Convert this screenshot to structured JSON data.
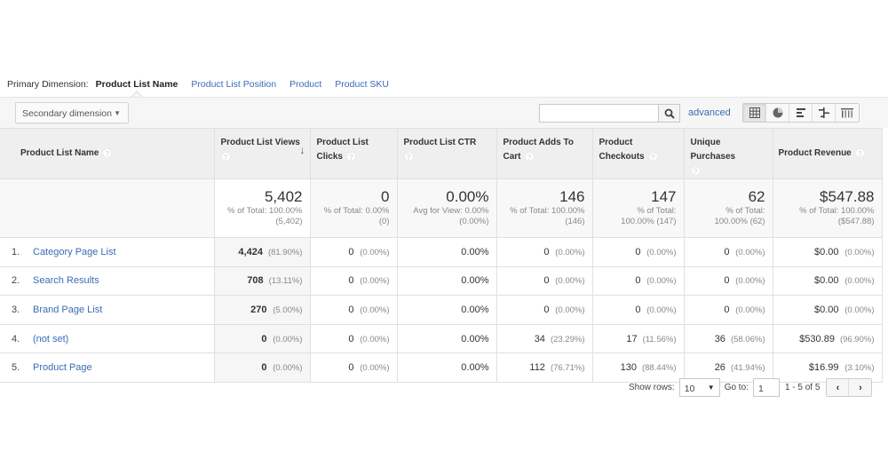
{
  "primary_dimension": {
    "label": "Primary Dimension:",
    "active": "Product List Name",
    "options": [
      "Product List Position",
      "Product",
      "Product SKU"
    ]
  },
  "toolbar": {
    "secondary_dimension_label": "Secondary dimension",
    "search_value": "",
    "advanced_label": "advanced",
    "view_icons": [
      "table-view-icon",
      "pie-view-icon",
      "performance-view-icon",
      "comparison-view-icon",
      "pivot-view-icon"
    ]
  },
  "table": {
    "columns": [
      {
        "label": "Product List Name"
      },
      {
        "label": "Product List Views",
        "sorted": true
      },
      {
        "label": "Product List Clicks"
      },
      {
        "label": "Product List CTR"
      },
      {
        "label": "Product Adds To Cart"
      },
      {
        "label": "Product Checkouts"
      },
      {
        "label": "Unique Purchases"
      },
      {
        "label": "Product Revenue"
      }
    ],
    "totals": [
      {
        "value": "5,402",
        "sub1": "% of Total: 100.00%",
        "sub2": "(5,402)"
      },
      {
        "value": "0",
        "sub1": "% of Total: 0.00%",
        "sub2": "(0)"
      },
      {
        "value": "0.00%",
        "sub1": "Avg for View: 0.00%",
        "sub2": "(0.00%)"
      },
      {
        "value": "146",
        "sub1": "% of Total: 100.00%",
        "sub2": "(146)"
      },
      {
        "value": "147",
        "sub1": "% of Total:",
        "sub2": "100.00% (147)"
      },
      {
        "value": "62",
        "sub1": "% of Total:",
        "sub2": "100.00% (62)"
      },
      {
        "value": "$547.88",
        "sub1": "% of Total: 100.00%",
        "sub2": "($547.88)"
      }
    ],
    "rows": [
      {
        "index": "1.",
        "name": "Category Page List",
        "cells": [
          {
            "v": "4,424",
            "p": "(81.90%)"
          },
          {
            "v": "0",
            "p": "(0.00%)"
          },
          {
            "v": "0.00%",
            "p": ""
          },
          {
            "v": "0",
            "p": "(0.00%)"
          },
          {
            "v": "0",
            "p": "(0.00%)"
          },
          {
            "v": "0",
            "p": "(0.00%)"
          },
          {
            "v": "$0.00",
            "p": "(0.00%)"
          }
        ]
      },
      {
        "index": "2.",
        "name": "Search Results",
        "cells": [
          {
            "v": "708",
            "p": "(13.11%)"
          },
          {
            "v": "0",
            "p": "(0.00%)"
          },
          {
            "v": "0.00%",
            "p": ""
          },
          {
            "v": "0",
            "p": "(0.00%)"
          },
          {
            "v": "0",
            "p": "(0.00%)"
          },
          {
            "v": "0",
            "p": "(0.00%)"
          },
          {
            "v": "$0.00",
            "p": "(0.00%)"
          }
        ]
      },
      {
        "index": "3.",
        "name": "Brand Page List",
        "cells": [
          {
            "v": "270",
            "p": "(5.00%)"
          },
          {
            "v": "0",
            "p": "(0.00%)"
          },
          {
            "v": "0.00%",
            "p": ""
          },
          {
            "v": "0",
            "p": "(0.00%)"
          },
          {
            "v": "0",
            "p": "(0.00%)"
          },
          {
            "v": "0",
            "p": "(0.00%)"
          },
          {
            "v": "$0.00",
            "p": "(0.00%)"
          }
        ]
      },
      {
        "index": "4.",
        "name": "(not set)",
        "cells": [
          {
            "v": "0",
            "p": "(0.00%)"
          },
          {
            "v": "0",
            "p": "(0.00%)"
          },
          {
            "v": "0.00%",
            "p": ""
          },
          {
            "v": "34",
            "p": "(23.29%)"
          },
          {
            "v": "17",
            "p": "(11.56%)"
          },
          {
            "v": "36",
            "p": "(58.06%)"
          },
          {
            "v": "$530.89",
            "p": "(96.90%)"
          }
        ]
      },
      {
        "index": "5.",
        "name": "Product Page",
        "cells": [
          {
            "v": "0",
            "p": "(0.00%)"
          },
          {
            "v": "0",
            "p": "(0.00%)"
          },
          {
            "v": "0.00%",
            "p": ""
          },
          {
            "v": "112",
            "p": "(76.71%)"
          },
          {
            "v": "130",
            "p": "(88.44%)"
          },
          {
            "v": "26",
            "p": "(41.94%)"
          },
          {
            "v": "$16.99",
            "p": "(3.10%)"
          }
        ]
      }
    ]
  },
  "pager": {
    "show_rows_label": "Show rows:",
    "show_rows_value": "10",
    "goto_label": "Go to:",
    "goto_value": "1",
    "range": "1 - 5 of 5"
  },
  "colors": {
    "link": "#3a6cb4",
    "header_bg": "#efefef",
    "sorted_bg": "#f6f6f6"
  }
}
